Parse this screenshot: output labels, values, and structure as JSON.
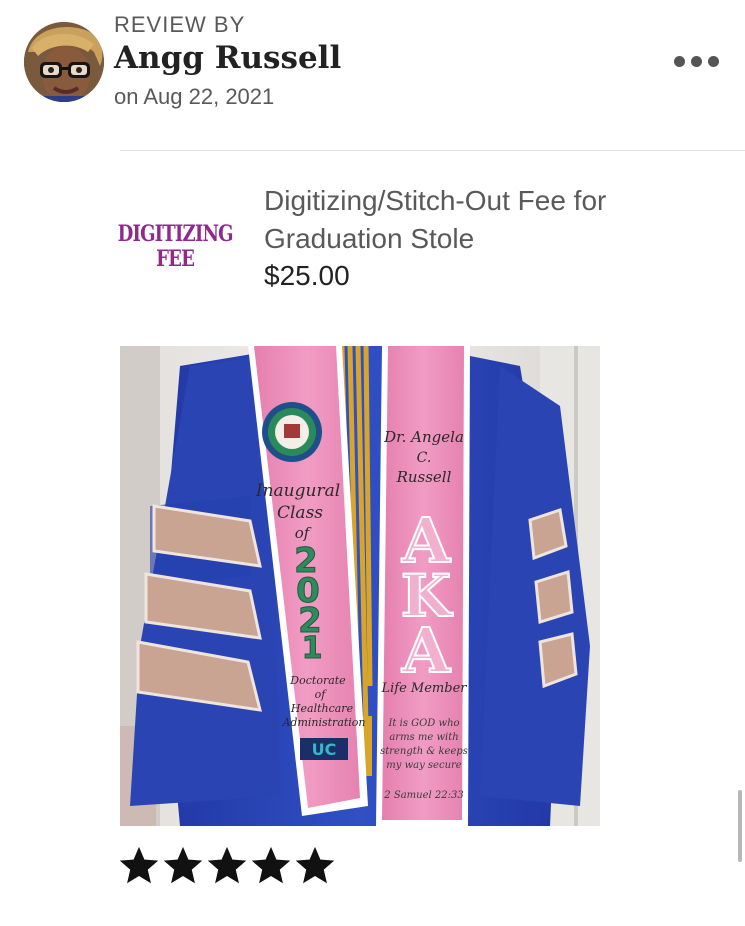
{
  "review": {
    "label": "REVIEW BY",
    "reviewer_name": "Angg Russell",
    "date": "on Aug 22, 2021",
    "rating": 5,
    "rating_max": 5
  },
  "item": {
    "thumb_line1": "DIGITIZING",
    "thumb_line2": "FEE",
    "title": "Digitizing/Stitch-Out Fee for Graduation Stole",
    "price": "$25.00"
  },
  "photo": {
    "stole_left_lines": [
      "Inaugural",
      "Class",
      "of",
      "2",
      "0",
      "2",
      "1",
      "Doctorate",
      "of",
      "Healthcare",
      "Administration"
    ],
    "stole_right_top": [
      "Dr. Angela",
      "C.",
      "Russell"
    ],
    "stole_right_letters": [
      "A",
      "K",
      "A"
    ],
    "stole_right_bottom": [
      "Life Member"
    ],
    "stole_right_verse": [
      "It is GOD who",
      "arms me with",
      "strength & keeps",
      "my way secure"
    ],
    "stole_right_ref": "2 Samuel 22:33",
    "stole_logo": "UC"
  },
  "colors": {
    "gown_blue": "#2a45b3",
    "stole_pink": "#ec8fba",
    "velvet": "#c9a493",
    "thumb_purple": "#8e2a8c",
    "text_gray": "#595959"
  },
  "icons": {
    "more": "more-horizontal-icon",
    "star": "star-icon"
  }
}
